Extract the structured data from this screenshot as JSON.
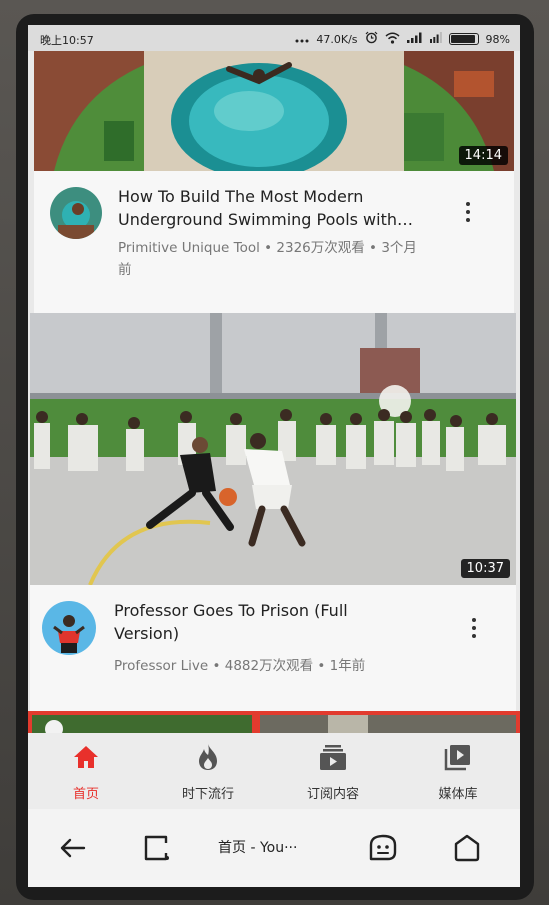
{
  "status_bar": {
    "time": "晚上10:57",
    "network_speed": "47.0K/s",
    "battery": "98%"
  },
  "videos": [
    {
      "duration": "14:14",
      "title_line1": "How To Build The Most Modern",
      "title_line2": "Underground Swimming Pools with…",
      "meta_line1": "Primitive Unique Tool • 2326万次观看 • 3个月",
      "meta_line2": "前"
    },
    {
      "duration": "10:37",
      "title_line1": "Professor Goes To Prison (Full",
      "title_line2": "Version)",
      "meta_line1": "Professor Live • 4882万次观看 • 1年前"
    }
  ],
  "tabs": [
    {
      "label": "首页",
      "icon": "home-icon",
      "active": true
    },
    {
      "label": "时下流行",
      "icon": "flame-icon",
      "active": false
    },
    {
      "label": "订阅内容",
      "icon": "subscriptions-icon",
      "active": false
    },
    {
      "label": "媒体库",
      "icon": "library-icon",
      "active": false
    }
  ],
  "browser_bar": {
    "url_title": "首页 - You···"
  },
  "colors": {
    "accent_red": "#e8302b",
    "text_primary": "#222222",
    "text_secondary": "#777777"
  }
}
